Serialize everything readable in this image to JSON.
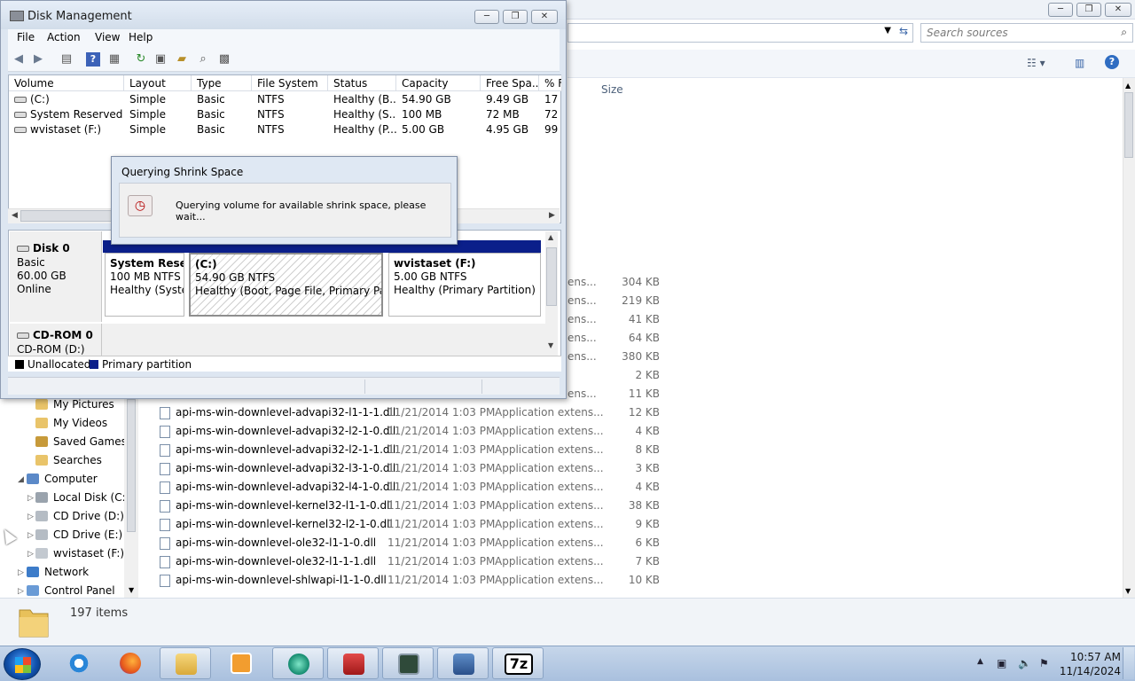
{
  "explorer": {
    "search_placeholder": "Search sources",
    "col_size": "Size",
    "partial_rows": [
      {
        "type": "ens...",
        "size": "304 KB"
      },
      {
        "type": "ens...",
        "size": "219 KB"
      },
      {
        "type": "ens...",
        "size": "41 KB"
      },
      {
        "type": "ens...",
        "size": "64 KB"
      },
      {
        "type": "ens...",
        "size": "380 KB"
      },
      {
        "type": "",
        "size": "2 KB"
      },
      {
        "type": "ens...",
        "size": "11 KB"
      }
    ],
    "files": [
      {
        "name": "api-ms-win-downlevel-advapi32-l1-1-1.dll",
        "date": "11/21/2014 1:03 PM",
        "type": "Application extens...",
        "size": "12 KB"
      },
      {
        "name": "api-ms-win-downlevel-advapi32-l2-1-0.dll",
        "date": "11/21/2014 1:03 PM",
        "type": "Application extens...",
        "size": "4 KB"
      },
      {
        "name": "api-ms-win-downlevel-advapi32-l2-1-1.dll",
        "date": "11/21/2014 1:03 PM",
        "type": "Application extens...",
        "size": "8 KB"
      },
      {
        "name": "api-ms-win-downlevel-advapi32-l3-1-0.dll",
        "date": "11/21/2014 1:03 PM",
        "type": "Application extens...",
        "size": "3 KB"
      },
      {
        "name": "api-ms-win-downlevel-advapi32-l4-1-0.dll",
        "date": "11/21/2014 1:03 PM",
        "type": "Application extens...",
        "size": "4 KB"
      },
      {
        "name": "api-ms-win-downlevel-kernel32-l1-1-0.dll",
        "date": "11/21/2014 1:03 PM",
        "type": "Application extens...",
        "size": "38 KB"
      },
      {
        "name": "api-ms-win-downlevel-kernel32-l2-1-0.dll",
        "date": "11/21/2014 1:03 PM",
        "type": "Application extens...",
        "size": "9 KB"
      },
      {
        "name": "api-ms-win-downlevel-ole32-l1-1-0.dll",
        "date": "11/21/2014 1:03 PM",
        "type": "Application extens...",
        "size": "6 KB"
      },
      {
        "name": "api-ms-win-downlevel-ole32-l1-1-1.dll",
        "date": "11/21/2014 1:03 PM",
        "type": "Application extens...",
        "size": "7 KB"
      },
      {
        "name": "api-ms-win-downlevel-shlwapi-l1-1-0.dll",
        "date": "11/21/2014 1:03 PM",
        "type": "Application extens...",
        "size": "10 KB"
      }
    ],
    "nav": {
      "my_pictures": "My Pictures",
      "my_videos": "My Videos",
      "saved_games": "Saved Games",
      "searches": "Searches",
      "computer": "Computer",
      "local_disk": "Local Disk (C:)",
      "cd_d": "CD Drive (D:)",
      "cd_e": "CD Drive (E:) J_",
      "wvistaset": "wvistaset (F:)",
      "network": "Network",
      "control_panel": "Control Panel"
    },
    "items_count": "197 items"
  },
  "dm": {
    "title": "Disk Management",
    "menu": [
      "File",
      "Action",
      "View",
      "Help"
    ],
    "columns": [
      "Volume",
      "Layout",
      "Type",
      "File System",
      "Status",
      "Capacity",
      "Free Spa...",
      "% F"
    ],
    "rows": [
      [
        "(C:)",
        "Simple",
        "Basic",
        "NTFS",
        "Healthy (B...",
        "54.90 GB",
        "9.49 GB",
        "17"
      ],
      [
        "System Reserved",
        "Simple",
        "Basic",
        "NTFS",
        "Healthy (S...",
        "100 MB",
        "72 MB",
        "72"
      ],
      [
        "wvistaset (F:)",
        "Simple",
        "Basic",
        "NTFS",
        "Healthy (P...",
        "5.00 GB",
        "4.95 GB",
        "99"
      ]
    ],
    "disk0": {
      "name": "Disk 0",
      "type": "Basic",
      "size": "60.00 GB",
      "state": "Online"
    },
    "cdrom0": {
      "name": "CD-ROM 0",
      "drive": "CD-ROM (D:)"
    },
    "partitions": [
      {
        "name": "System Reserv",
        "size": "100 MB NTFS",
        "status": "Healthy (Syster"
      },
      {
        "name": "(C:)",
        "size": "54.90 GB NTFS",
        "status": "Healthy (Boot, Page File, Primary Partiti"
      },
      {
        "name": "wvistaset  (F:)",
        "size": "5.00 GB NTFS",
        "status": "Healthy (Primary Partition)"
      }
    ],
    "legend": {
      "unallocated": "Unallocated",
      "primary": "Primary partition"
    }
  },
  "dialog": {
    "title": "Querying Shrink Space",
    "message": "Querying volume for available shrink space, please wait..."
  },
  "taskbar": {
    "time": "10:57 AM",
    "date": "11/14/2024",
    "apps": [
      "internet-explorer",
      "firefox",
      "windows-explorer",
      "media-player",
      "app-circle",
      "toolbox",
      "monitor",
      "computer-manager",
      "7zip"
    ],
    "sevenzip_label": "7z"
  },
  "colors": {
    "primary_partition": "#0b1f8a",
    "unallocated": "#000000",
    "title_bar": "#dde6f1"
  }
}
